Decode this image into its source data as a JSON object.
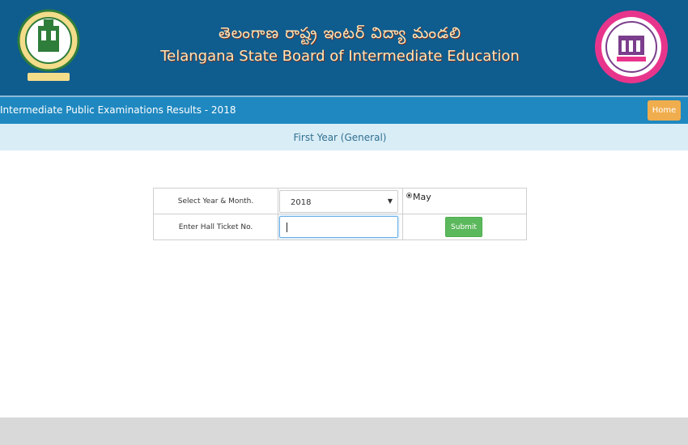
{
  "header": {
    "title_telugu": "తెలంగాణ రాష్ట్ర ఇంటర్ విద్యా మండలి",
    "title_english": "Telangana State Board of Intermediate Education",
    "logo_left_icon": "government-of-telangana-seal-icon",
    "logo_right_icon": "tsbie-emblem-icon"
  },
  "nav": {
    "title": "Intermediate Public Examinations Results - 2018",
    "home_label": "Home"
  },
  "subheader": {
    "title": "First Year (General)"
  },
  "form": {
    "year_month_label": "Select Year & Month.",
    "year_value": "2018",
    "month_option": "May",
    "hall_ticket_label": "Enter Hall Ticket No.",
    "hall_ticket_value": "",
    "submit_label": "Submit"
  },
  "colors": {
    "banner": "#0f5c8f",
    "navbar": "#1f88c0",
    "subbar": "#d9edf7",
    "home_button": "#f0ad4e",
    "submit_button": "#5cb85c"
  }
}
